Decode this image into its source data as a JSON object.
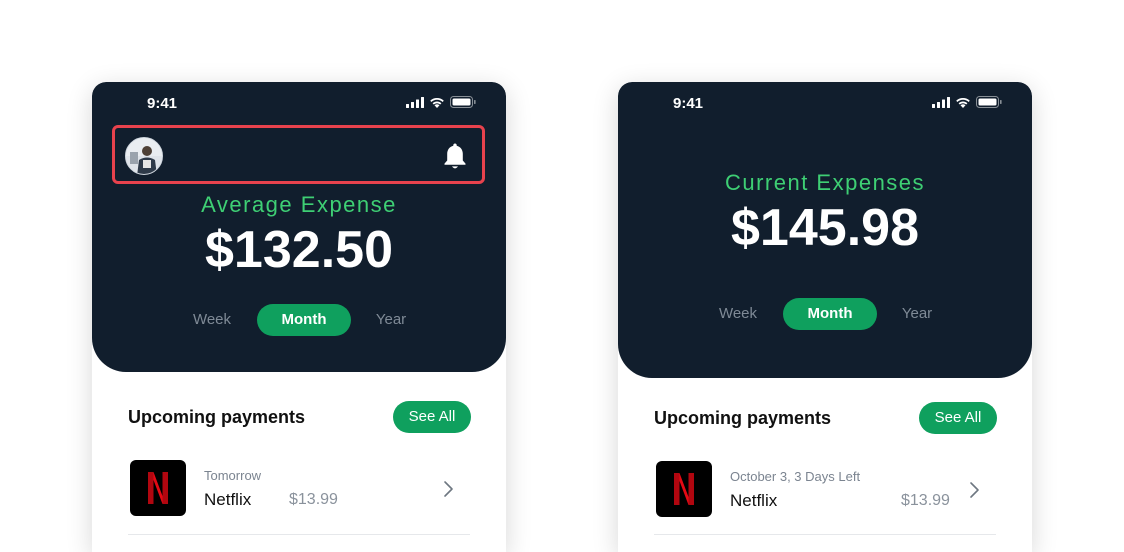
{
  "colors": {
    "header_bg": "#111e2d",
    "accent_green": "#0fa05e",
    "label_green": "#3ecf74",
    "highlight_red": "#e8424d"
  },
  "screens": [
    {
      "status_time": "9:41",
      "label": "Average Expense",
      "amount": "$132.50",
      "tabs": [
        "Week",
        "Month",
        "Year"
      ],
      "active_tab": "Month",
      "section_title": "Upcoming payments",
      "see_all": "See All",
      "payment": {
        "when": "Tomorrow",
        "name": "Netflix",
        "price": "$13.99",
        "logo": "N"
      }
    },
    {
      "status_time": "9:41",
      "label": "Current Expenses",
      "amount": "$145.98",
      "tabs": [
        "Week",
        "Month",
        "Year"
      ],
      "active_tab": "Month",
      "section_title": "Upcoming payments",
      "see_all": "See All",
      "payment": {
        "when": "October 3, 3 Days Left",
        "name": "Netflix",
        "price": "$13.99",
        "logo": "N"
      }
    }
  ],
  "icons": [
    "signal-icon",
    "wifi-icon",
    "battery-icon",
    "avatar",
    "bell-icon",
    "netflix-logo",
    "chevron-right-icon"
  ]
}
